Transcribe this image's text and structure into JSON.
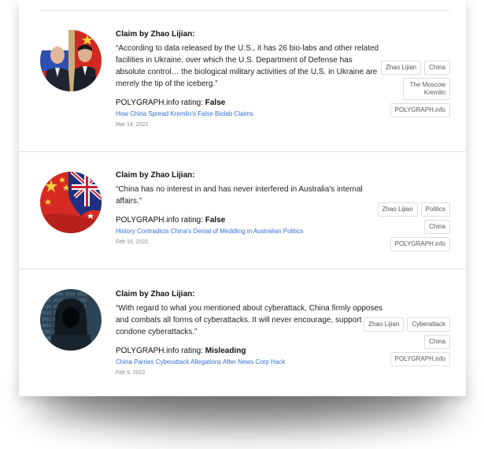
{
  "claims": [
    {
      "claim_by": "Claim by Zhao Lijian:",
      "quote": "“According to data released by the U.S., it has 26 bio-labs and other related facilities in Ukraine, over which the U.S. Department of Defense has absolute control… the biological military activities of the U.S. in Ukraine are merely the tip of the iceberg.”",
      "rating_prefix": "POLYGRAPH.info rating:",
      "rating_value": "False",
      "headline": "How China Spread Kremlin's False Biolab Claims",
      "date": "Mar 14, 2022",
      "tags": [
        "Zhao Lijian",
        "China",
        "The Moscow Kremlin",
        "POLYGRAPH.info"
      ],
      "image": "putin-xi-flags-photo"
    },
    {
      "claim_by": "Claim by Zhao Lijian:",
      "quote": "“China has no interest in and has never interfered in Australia's internal affairs.”",
      "rating_prefix": "POLYGRAPH.info rating:",
      "rating_value": "False",
      "headline": "History Contradicts China's Denial of Meddling in Australian Politics",
      "date": "Feb 16, 2022",
      "tags": [
        "Zhao Lijian",
        "Politics",
        "China",
        "POLYGRAPH.info"
      ],
      "image": "china-australia-flags-photo"
    },
    {
      "claim_by": "Claim by Zhao Lijian:",
      "quote": "“With regard to what you mentioned about cyberattack, China firmly opposes and combats all forms of cyberattacks. It will never encourage, support or condone cyberattacks.”",
      "rating_prefix": "POLYGRAPH.info rating:",
      "rating_value": "Misleading",
      "headline": "China Parries Cyberattack Allegations After News Corp Hack",
      "date": "Feb 9, 2022",
      "tags": [
        "Zhao Lijian",
        "Cyberattack",
        "China",
        "POLYGRAPH.info"
      ],
      "image": "hooded-hacker-photo"
    }
  ],
  "colors": {
    "link": "#2f6fd6",
    "date": "#888888",
    "tag_border": "#dedede"
  }
}
